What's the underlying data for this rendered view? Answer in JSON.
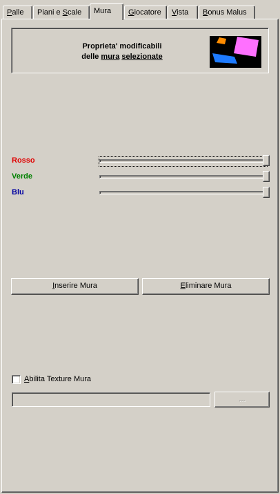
{
  "tabs": [
    {
      "label": "Palle",
      "ul": "P",
      "rest": "alle"
    },
    {
      "label": "Piani e Scale",
      "pre": "Piani e ",
      "ul": "S",
      "rest": "cale"
    },
    {
      "label": "Mura",
      "ul": "",
      "rest": "Mura"
    },
    {
      "label": "Giocatore",
      "ul": "G",
      "rest": "iocatore"
    },
    {
      "label": "Vista",
      "ul": "V",
      "rest": "ista"
    },
    {
      "label": "Bonus Malus",
      "ul": "B",
      "rest": "onus Malus"
    }
  ],
  "header": {
    "line1": "Proprieta' modificabili",
    "line2_pre": "delle ",
    "line2_mura": "mura",
    "line2_sep": " ",
    "line2_sel": "selezionate"
  },
  "colors": {
    "rosso": {
      "label": "Rosso",
      "color": "#e00000",
      "value": 255,
      "max": 255
    },
    "verde": {
      "label": "Verde",
      "color": "#008000",
      "value": 255,
      "max": 255
    },
    "blu": {
      "label": "Blu",
      "color": "#0000a0",
      "value": 255,
      "max": 255
    }
  },
  "buttons": {
    "insert_ul": "I",
    "insert_rest": "nserire Mura",
    "delete_ul": "E",
    "delete_rest": "liminare Mura",
    "browse": "..."
  },
  "texture": {
    "checkbox_ul": "A",
    "checkbox_rest": "bilita Texture Mura",
    "checked": false,
    "path_value": ""
  }
}
